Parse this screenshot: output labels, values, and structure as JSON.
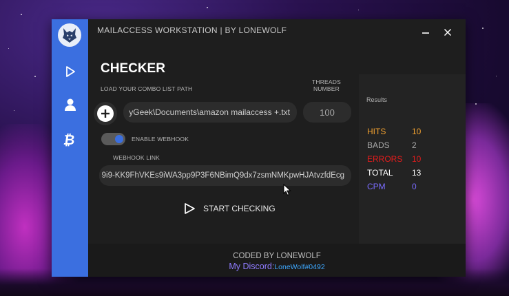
{
  "window": {
    "title": "MAILACCESS WORKSTATION | BY LONEWOLF"
  },
  "sidebar": {
    "items": [
      {
        "name": "play-icon"
      },
      {
        "name": "user-icon"
      },
      {
        "name": "bitcoin-icon"
      }
    ]
  },
  "checker": {
    "heading": "CHECKER",
    "combo_label": "LOAD YOUR COMBO LIST PATH",
    "threads_label_line1": "THREADS",
    "threads_label_line2": "NUMBER",
    "combo_path": "yGeek\\Documents\\amazon mailaccess +.txt",
    "threads_value": "100",
    "webhook_toggle_label": "ENABLE WEBHOOK",
    "webhook_enabled": true,
    "webhook_label": "WEBHOOK LINK",
    "webhook_value": "9i9-KK9FhVKEs9iWA3pp9P3F6NBimQ9dx7zsmNMKpwHJAtvzfdEcg",
    "start_label": "START CHECKING"
  },
  "results": {
    "title": "Results",
    "rows": [
      {
        "label": "HITS",
        "value": "10",
        "color": "#f0a030"
      },
      {
        "label": "BADS",
        "value": "2",
        "color": "#a8a8a8"
      },
      {
        "label": "ERRORS",
        "value": "10",
        "color": "#e21c1c"
      },
      {
        "label": "TOTAL",
        "value": "13",
        "color": "#ffffff"
      },
      {
        "label": "CPM",
        "value": "0",
        "color": "#7a6cff"
      }
    ]
  },
  "footer": {
    "coded_by": "CODED BY LONEWOLF",
    "discord_label": "My Discord:",
    "discord_value": "LoneWolf#0492"
  },
  "colors": {
    "accent": "#3b6fe0",
    "discord_label": "#8f7cff",
    "discord_value": "#3ea8ff"
  }
}
